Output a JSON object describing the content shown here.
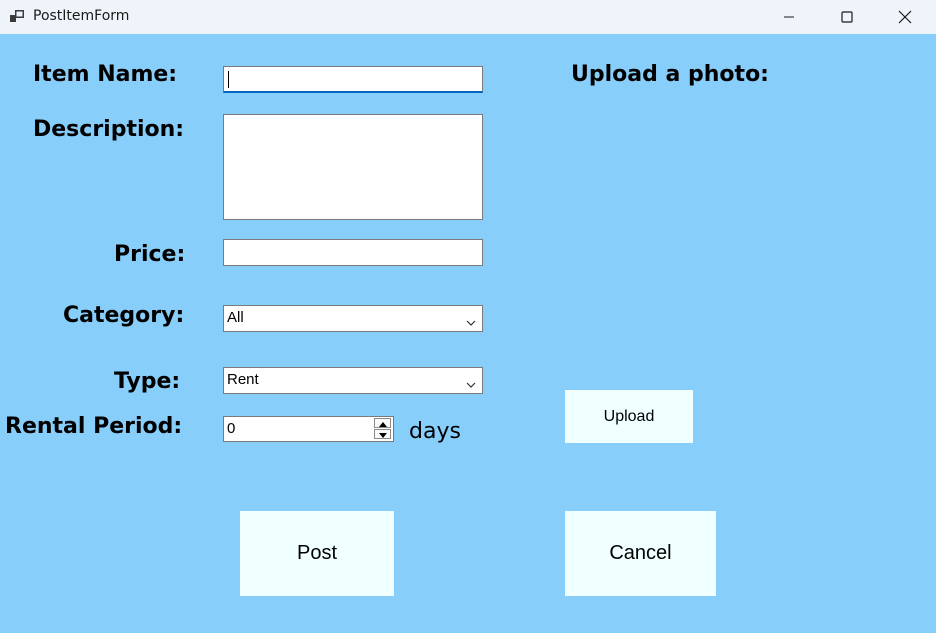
{
  "window": {
    "title": "PostItemForm",
    "controls": [
      "minimize-icon",
      "maximize-icon",
      "close-icon"
    ]
  },
  "form": {
    "item_name_label": "Item Name:",
    "item_name_value": "",
    "description_label": "Description:",
    "description_value": "",
    "price_label": "Price:",
    "price_value": "",
    "category_label": "Category:",
    "category_selected": "All",
    "type_label": "Type:",
    "type_selected": "Rent",
    "rental_period_label": "Rental Period:",
    "rental_period_value": "0",
    "rental_period_unit": "days",
    "upload_label": "Upload a photo:",
    "upload_button": "Upload",
    "post_button": "Post",
    "cancel_button": "Cancel"
  },
  "colors": {
    "background": "#87cefa",
    "button_bg": "#f0ffff",
    "titlebar_bg": "#eef4f9",
    "focus_accent": "#0067c0"
  }
}
